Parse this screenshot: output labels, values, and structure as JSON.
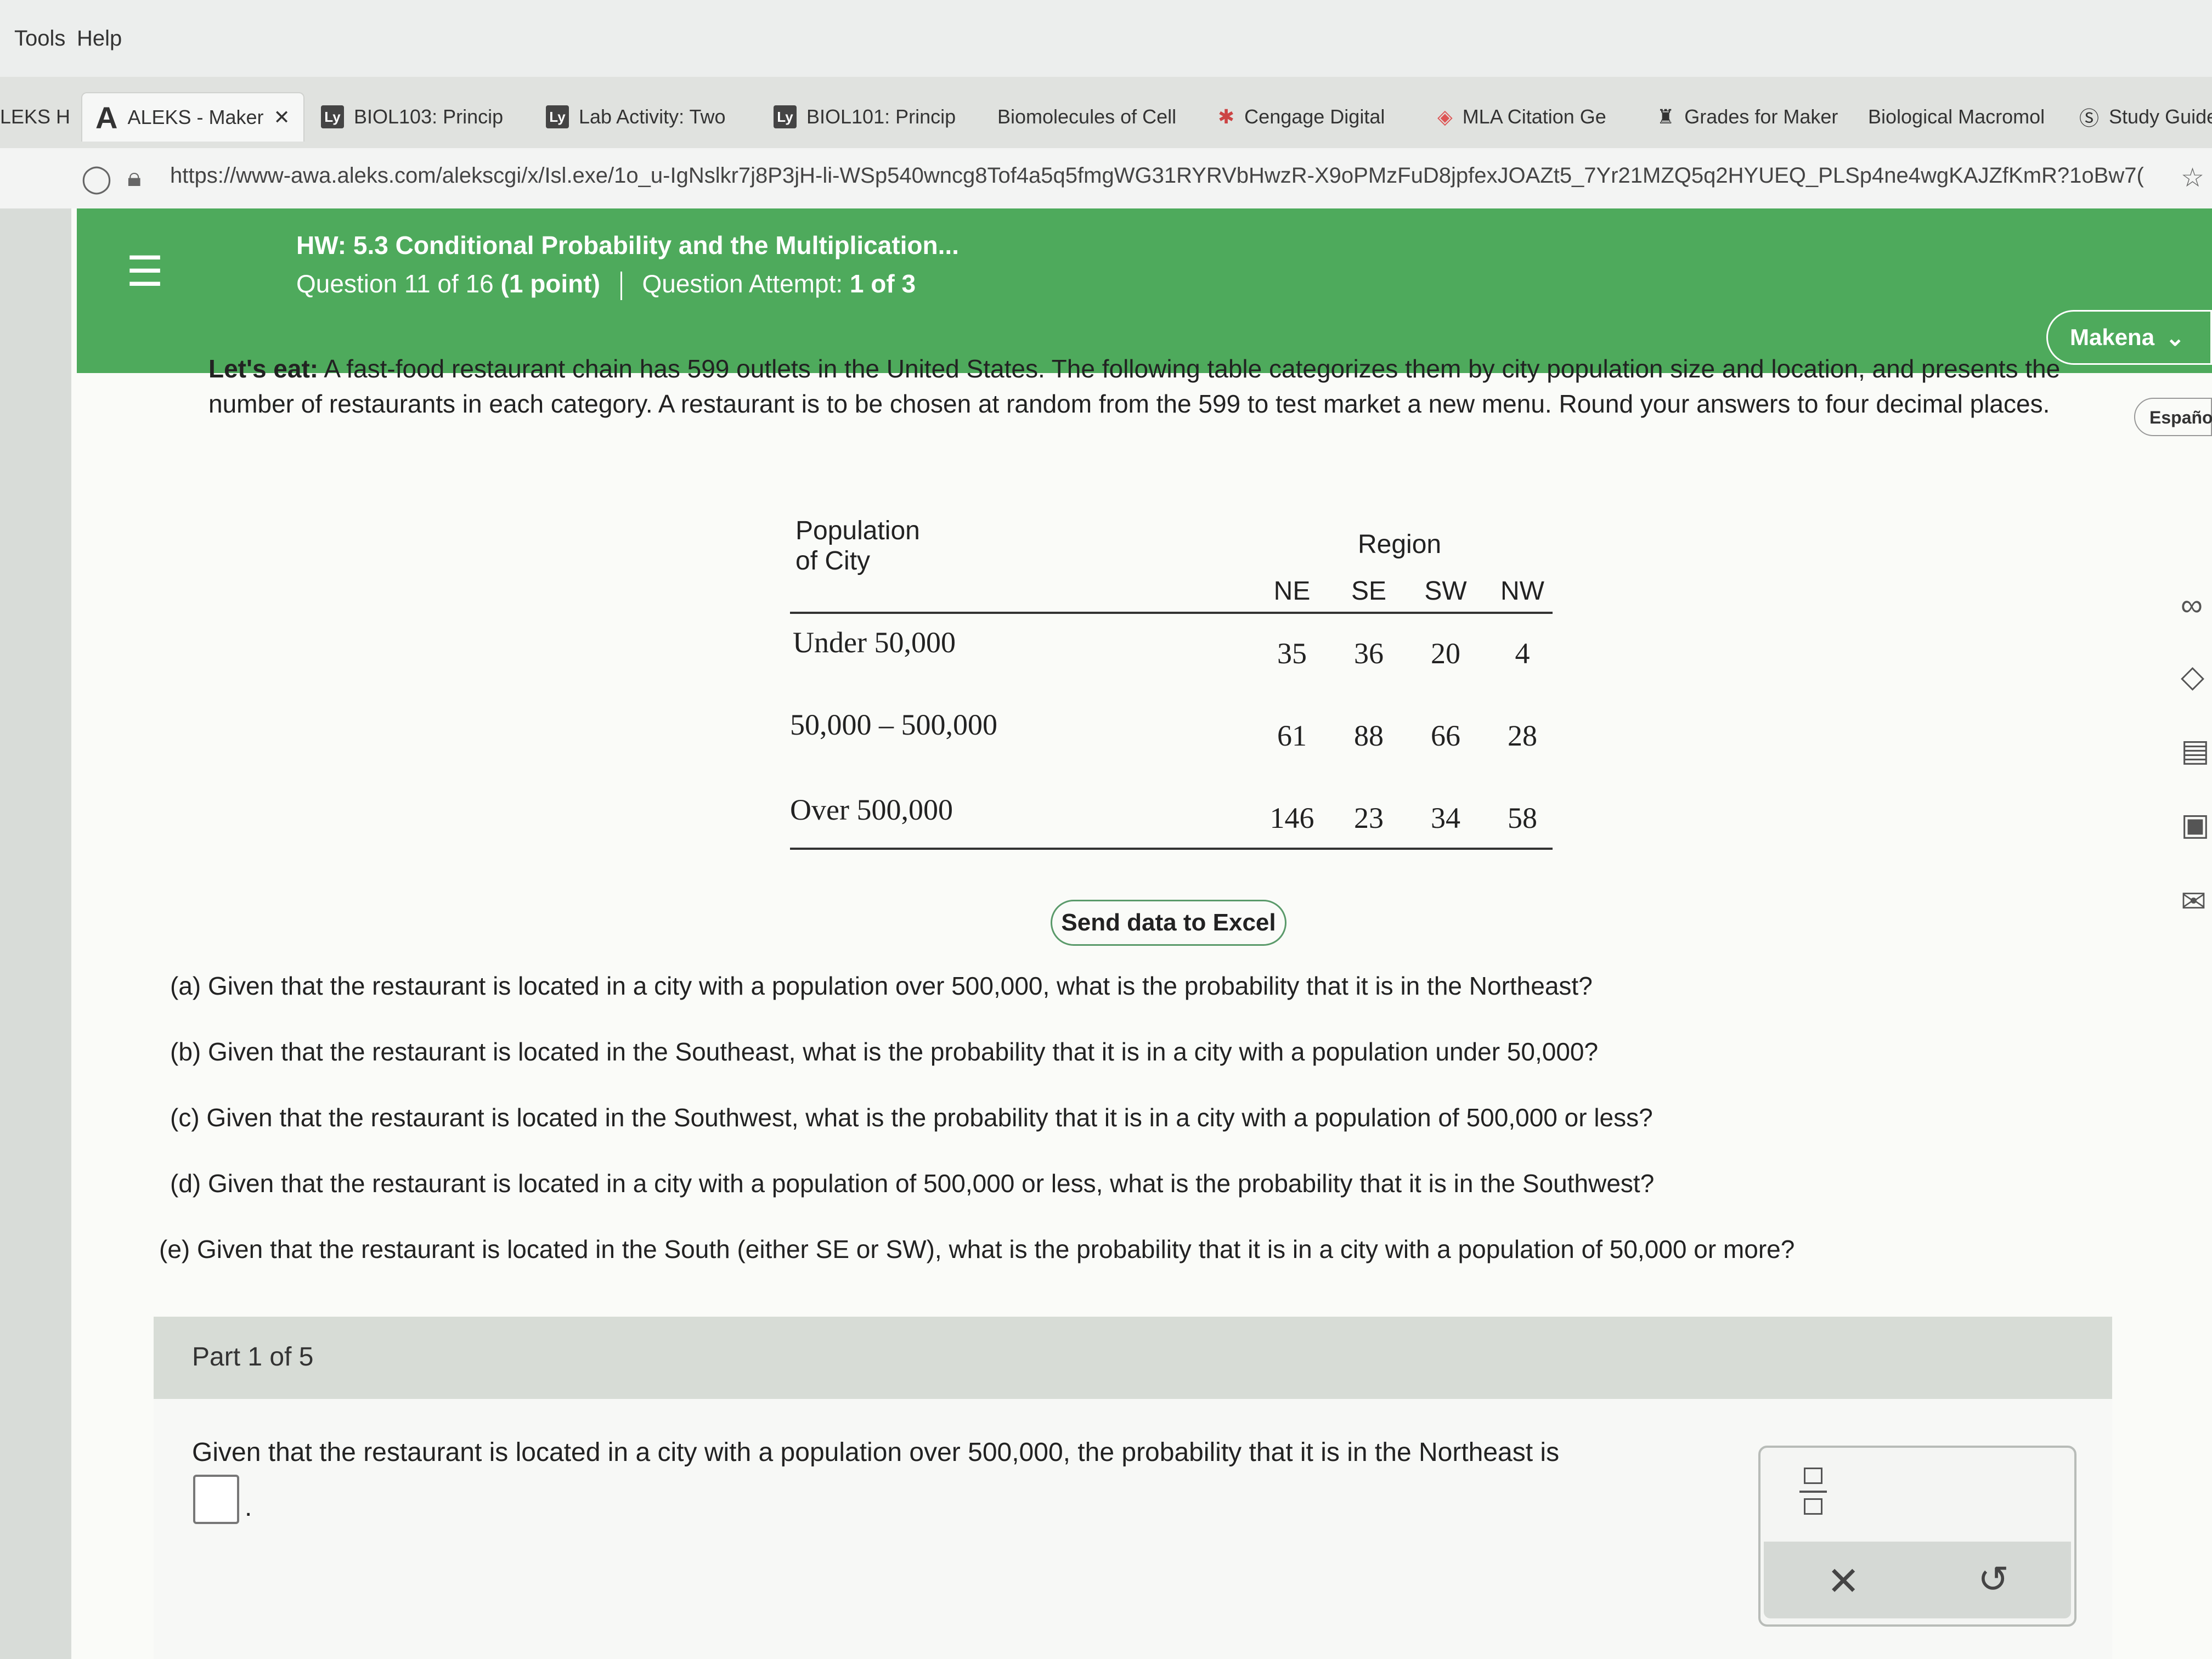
{
  "menu": {
    "tools": "Tools",
    "help": "Help"
  },
  "tabs": [
    {
      "label": "LEKS H"
    },
    {
      "label": "ALEKS - Maker"
    },
    {
      "label": "BIOL103: Princip"
    },
    {
      "label": "Lab Activity: Two"
    },
    {
      "label": "BIOL101: Princip"
    },
    {
      "label": "Biomolecules of Cell"
    },
    {
      "label": "Cengage Digital"
    },
    {
      "label": "MLA Citation Ge"
    },
    {
      "label": "Grades for Maker"
    },
    {
      "label": "Biological Macromol"
    },
    {
      "label": "Study Guide"
    }
  ],
  "url": "https://www-awa.aleks.com/alekscgi/x/Isl.exe/1o_u-IgNslkr7j8P3jH-li-WSp540wncg8Tof4a5q5fmgWG31RYRVbHwzR-X9oPMzFuD8jpfexJOAZt5_7Yr21MZQ5q2HYUEQ_PLSp4ne4wgKAJZfKmR?1oBw7(",
  "header": {
    "title": "HW: 5.3 Conditional Probability and the Multiplication...",
    "question": "Question 11 of 16",
    "points": "(1 point)",
    "attempt_label": "Question Attempt:",
    "attempt_value": "1 of 3",
    "user": "Makena",
    "espanol": "Español"
  },
  "problem": {
    "lead": "Let's eat:",
    "text": " A fast-food restaurant chain has 599 outlets in the United States. The following table categorizes them by city population size and location, and presents the number of restaurants in each category. A restaurant is to be chosen at random from the 599 to test market a new menu. Round your answers to four decimal places."
  },
  "table": {
    "row_header_line1": "Population",
    "row_header_line2": "of City",
    "col_group": "Region",
    "columns": [
      "NE",
      "SE",
      "SW",
      "NW"
    ],
    "rows": [
      {
        "label": "Under 50,000",
        "values": [
          "35",
          "36",
          "20",
          "4"
        ]
      },
      {
        "label": "50,000 – 500,000",
        "values": [
          "61",
          "88",
          "66",
          "28"
        ]
      },
      {
        "label": "Over 500,000",
        "values": [
          "146",
          "23",
          "34",
          "58"
        ]
      }
    ]
  },
  "excel_button": "Send data to Excel",
  "questions": [
    "(a) Given that the restaurant is located in a city with a population over 500,000, what is the probability that it is in the Northeast?",
    "(b) Given that the restaurant is located in the Southeast, what is the probability that it is in a city with a population under 50,000?",
    "(c) Given that the restaurant is located in the Southwest, what is the probability that it is in a city with a population of 500,000 or less?",
    "(d) Given that the restaurant is located in a city with a population of 500,000 or less, what is the probability that it is in the Southwest?",
    "(e) Given that the restaurant is located in the South (either SE or SW), what is the probability that it is in a city with a population of 50,000 or more?"
  ],
  "part": {
    "label": "Part 1 of 5",
    "prompt": "Given that the restaurant is located in a city with a population over 500,000, the probability that it is in the Northeast is",
    "answer_value": ""
  },
  "colors": {
    "header_green": "#4eaa5c",
    "part_header": "#d7dcd6"
  }
}
